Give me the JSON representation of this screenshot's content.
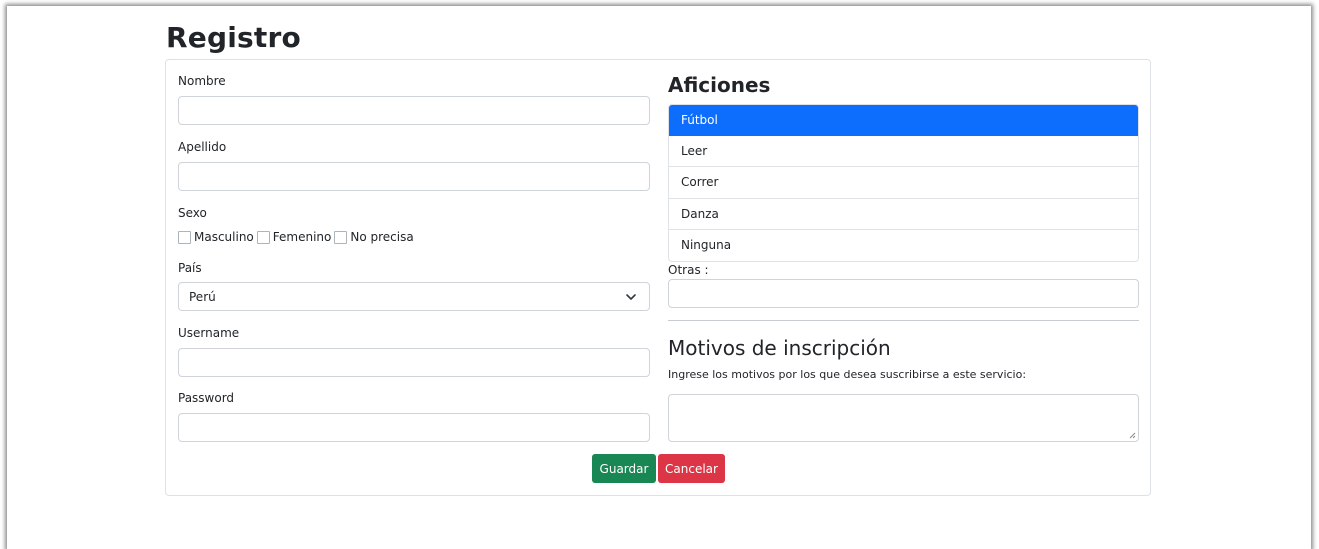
{
  "page": {
    "title": "Registro"
  },
  "form": {
    "nombre": {
      "label": "Nombre",
      "value": ""
    },
    "apellido": {
      "label": "Apellido",
      "value": ""
    },
    "sexo": {
      "label": "Sexo",
      "options": [
        "Masculino",
        "Femenino",
        "No precisa"
      ]
    },
    "pais": {
      "label": "País",
      "selected": "Perú"
    },
    "username": {
      "label": "Username",
      "value": ""
    },
    "password": {
      "label": "Password",
      "value": ""
    }
  },
  "aficiones": {
    "title": "Aficiones",
    "items": [
      {
        "label": "Fútbol",
        "active": true
      },
      {
        "label": "Leer",
        "active": false
      },
      {
        "label": "Correr",
        "active": false
      },
      {
        "label": "Danza",
        "active": false
      },
      {
        "label": "Ninguna",
        "active": false
      }
    ],
    "otras_label": "Otras :",
    "otras_value": ""
  },
  "motivos": {
    "title": "Motivos de inscripción",
    "description": "Ingrese los motivos por los que desea suscribirse a este servicio:",
    "value": ""
  },
  "actions": {
    "save_label": "Guardar",
    "cancel_label": "Cancelar"
  },
  "colors": {
    "primary": "#0d6efd",
    "success": "#198754",
    "danger": "#dc3545"
  },
  "icons": {
    "select_arrow": "chevron-down-icon",
    "resize": "resize-grip-icon"
  }
}
